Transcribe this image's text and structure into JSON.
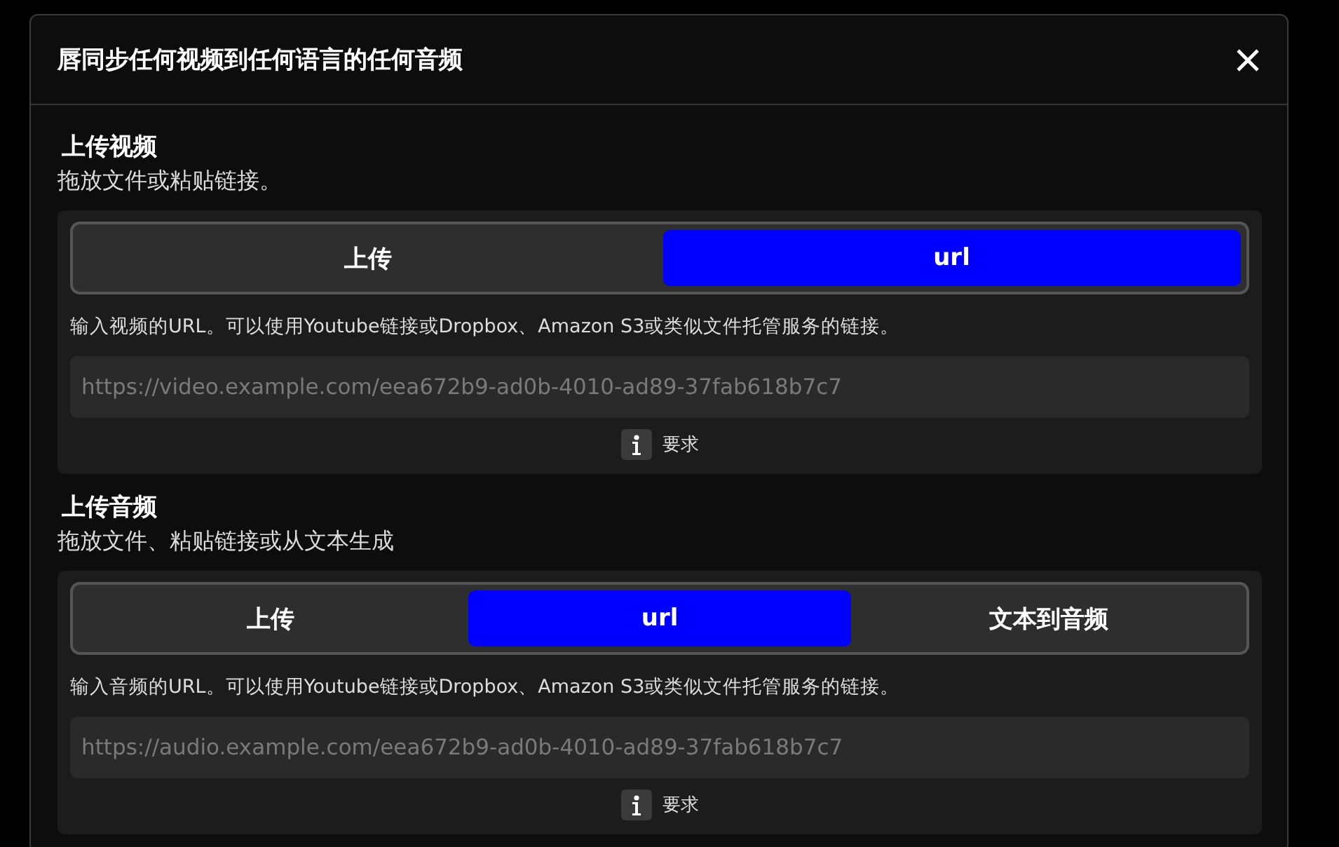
{
  "dialog": {
    "title": "唇同步任何视频到任何语言的任何音频"
  },
  "sections": [
    {
      "title": "上传视频",
      "subtitle": "拖放文件或粘贴链接。",
      "tabs": [
        {
          "label": "上传",
          "selected": false
        },
        {
          "label": "url",
          "selected": true
        }
      ],
      "hint": "输入视频的URL。可以使用Youtube链接或Dropbox、Amazon S3或类似文件托管服务的链接。",
      "url_field": {
        "placeholder": "https://video.example.com/eea672b9-ad0b-4010-ad89-37fab618b7c7"
      },
      "requirements": "要求"
    },
    {
      "title": "上传音频",
      "subtitle": "拖放文件、粘贴链接或从文本生成",
      "tabs": [
        {
          "label": "上传",
          "selected": false
        },
        {
          "label": "url",
          "selected": true
        },
        {
          "label": "文本到音频",
          "selected": false
        }
      ],
      "hint": "输入音频的URL。可以使用Youtube链接或Dropbox、Amazon S3或类似文件托管服务的链接。",
      "url_field": {
        "placeholder": "https://audio.example.com/eea672b9-ad0b-4010-ad89-37fab618b7c7"
      },
      "requirements": "要求"
    }
  ]
}
